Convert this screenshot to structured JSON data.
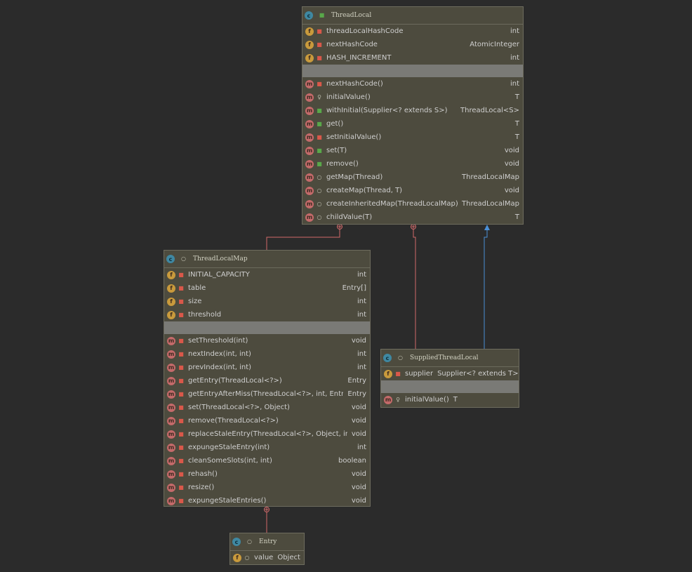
{
  "colors": {
    "background": "#2b2b2b",
    "box_fill": "#4d4b3e",
    "inner_class_link": "#d06a6a",
    "inheritance_link": "#4a8fd6"
  },
  "classes": {
    "thread_local": {
      "name": "ThreadLocal",
      "icon": "class-icon",
      "visibility": "public",
      "fields": [
        {
          "icon": "field-icon",
          "visibility": "private",
          "name": "threadLocalHashCode",
          "type": "int"
        },
        {
          "icon": "field-icon",
          "visibility": "private",
          "name": "nextHashCode",
          "type": "AtomicInteger"
        },
        {
          "icon": "field-icon",
          "visibility": "private",
          "name": "HASH_INCREMENT",
          "type": "int"
        }
      ],
      "methods": [
        {
          "icon": "method-icon",
          "visibility": "private",
          "name": "nextHashCode()",
          "type": "int"
        },
        {
          "icon": "method-icon",
          "visibility": "protected",
          "name": "initialValue()",
          "type": "T"
        },
        {
          "icon": "method-icon",
          "visibility": "public",
          "name": "withInitial(Supplier<? extends S>)",
          "type": "ThreadLocal<S>"
        },
        {
          "icon": "method-icon",
          "visibility": "public",
          "name": "get()",
          "type": "T"
        },
        {
          "icon": "method-icon",
          "visibility": "private",
          "name": "setInitialValue()",
          "type": "T"
        },
        {
          "icon": "method-icon",
          "visibility": "public",
          "name": "set(T)",
          "type": "void"
        },
        {
          "icon": "method-icon",
          "visibility": "public",
          "name": "remove()",
          "type": "void"
        },
        {
          "icon": "method-icon",
          "visibility": "package",
          "name": "getMap(Thread)",
          "type": "ThreadLocalMap"
        },
        {
          "icon": "method-icon",
          "visibility": "package",
          "name": "createMap(Thread, T)",
          "type": "void"
        },
        {
          "icon": "method-icon",
          "visibility": "package",
          "name": "createInheritedMap(ThreadLocalMap)",
          "type": "ThreadLocalMap"
        },
        {
          "icon": "method-icon",
          "visibility": "package",
          "name": "childValue(T)",
          "type": "T"
        }
      ]
    },
    "thread_local_map": {
      "name": "ThreadLocalMap",
      "icon": "class-icon",
      "visibility": "package",
      "fields": [
        {
          "icon": "field-icon",
          "visibility": "private",
          "name": "INITIAL_CAPACITY",
          "type": "int"
        },
        {
          "icon": "field-icon",
          "visibility": "private",
          "name": "table",
          "type": "Entry[]"
        },
        {
          "icon": "field-icon",
          "visibility": "private",
          "name": "size",
          "type": "int"
        },
        {
          "icon": "field-icon",
          "visibility": "private",
          "name": "threshold",
          "type": "int"
        }
      ],
      "methods": [
        {
          "icon": "method-icon",
          "visibility": "private",
          "name": "setThreshold(int)",
          "type": "void"
        },
        {
          "icon": "method-icon",
          "visibility": "private",
          "name": "nextIndex(int, int)",
          "type": "int"
        },
        {
          "icon": "method-icon",
          "visibility": "private",
          "name": "prevIndex(int, int)",
          "type": "int"
        },
        {
          "icon": "method-icon",
          "visibility": "private",
          "name": "getEntry(ThreadLocal<?>)",
          "type": "Entry"
        },
        {
          "icon": "method-icon",
          "visibility": "private",
          "name": "getEntryAfterMiss(ThreadLocal<?>, int, Entry)",
          "type": "Entry"
        },
        {
          "icon": "method-icon",
          "visibility": "private",
          "name": "set(ThreadLocal<?>, Object)",
          "type": "void"
        },
        {
          "icon": "method-icon",
          "visibility": "private",
          "name": "remove(ThreadLocal<?>)",
          "type": "void"
        },
        {
          "icon": "method-icon",
          "visibility": "private",
          "name": "replaceStaleEntry(ThreadLocal<?>, Object, int)",
          "type": "void"
        },
        {
          "icon": "method-icon",
          "visibility": "private",
          "name": "expungeStaleEntry(int)",
          "type": "int"
        },
        {
          "icon": "method-icon",
          "visibility": "private",
          "name": "cleanSomeSlots(int, int)",
          "type": "boolean"
        },
        {
          "icon": "method-icon",
          "visibility": "private",
          "name": "rehash()",
          "type": "void"
        },
        {
          "icon": "method-icon",
          "visibility": "private",
          "name": "resize()",
          "type": "void"
        },
        {
          "icon": "method-icon",
          "visibility": "private",
          "name": "expungeStaleEntries()",
          "type": "void"
        }
      ]
    },
    "supplied_thread_local": {
      "name": "SuppliedThreadLocal",
      "icon": "class-icon",
      "visibility": "package",
      "fields": [
        {
          "icon": "field-icon",
          "visibility": "private",
          "name": "supplier",
          "type": "Supplier<? extends T>"
        }
      ],
      "methods": [
        {
          "icon": "method-icon",
          "visibility": "protected",
          "name": "initialValue()",
          "type": "T"
        }
      ]
    },
    "entry": {
      "name": "Entry",
      "icon": "class-icon",
      "visibility": "package",
      "fields": [
        {
          "icon": "field-icon",
          "visibility": "package",
          "name": "value",
          "type": "Object"
        }
      ],
      "methods": []
    }
  },
  "relations": [
    {
      "from": "thread_local_map",
      "to": "thread_local",
      "kind": "inner-class"
    },
    {
      "from": "supplied_thread_local",
      "to": "thread_local",
      "kind": "inner-class"
    },
    {
      "from": "supplied_thread_local",
      "to": "thread_local",
      "kind": "extends"
    },
    {
      "from": "entry",
      "to": "thread_local_map",
      "kind": "inner-class"
    }
  ]
}
